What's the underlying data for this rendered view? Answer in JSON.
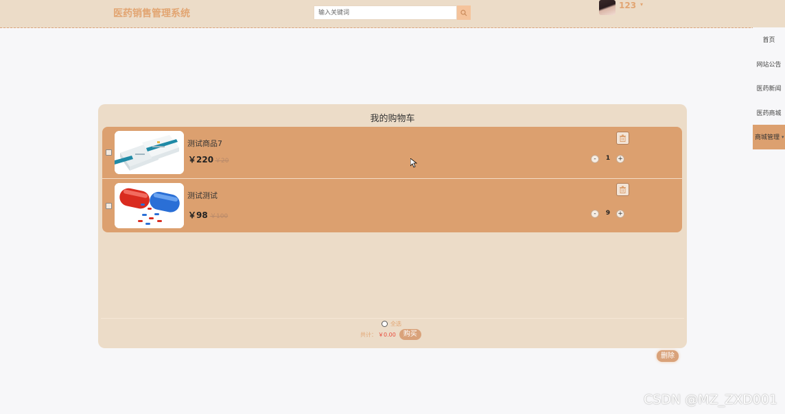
{
  "header": {
    "logo": "医药销售管理系统",
    "search_placeholder": "输入关键词",
    "username": "123",
    "caret": "▾"
  },
  "side_nav": {
    "items": [
      {
        "label": "首页"
      },
      {
        "label": "网站公告"
      },
      {
        "label": "医药新闻"
      },
      {
        "label": "医药商城"
      },
      {
        "label": "商城管理",
        "active": true
      }
    ],
    "caret": "▾"
  },
  "cart": {
    "title": "我的购物车",
    "items": [
      {
        "name": "测试商品7",
        "price": "￥220",
        "old_price": "￥20",
        "quantity": "1",
        "minus": "-",
        "plus": "+"
      },
      {
        "name": "测试测试",
        "price": "￥98",
        "old_price": "￥100",
        "quantity": "9",
        "minus": "-",
        "plus": "+"
      }
    ],
    "select_all": "全选",
    "total_label": "共计：",
    "total_value": "￥0.00",
    "buy_label": "购买",
    "delete_label": "删除"
  },
  "colors": {
    "accent": "#dca06f",
    "header_bg": "#ecdcc8",
    "brand_text": "#e2a572",
    "total_red": "#e84a3b"
  },
  "watermark": "CSDN @MZ_ZXD001"
}
